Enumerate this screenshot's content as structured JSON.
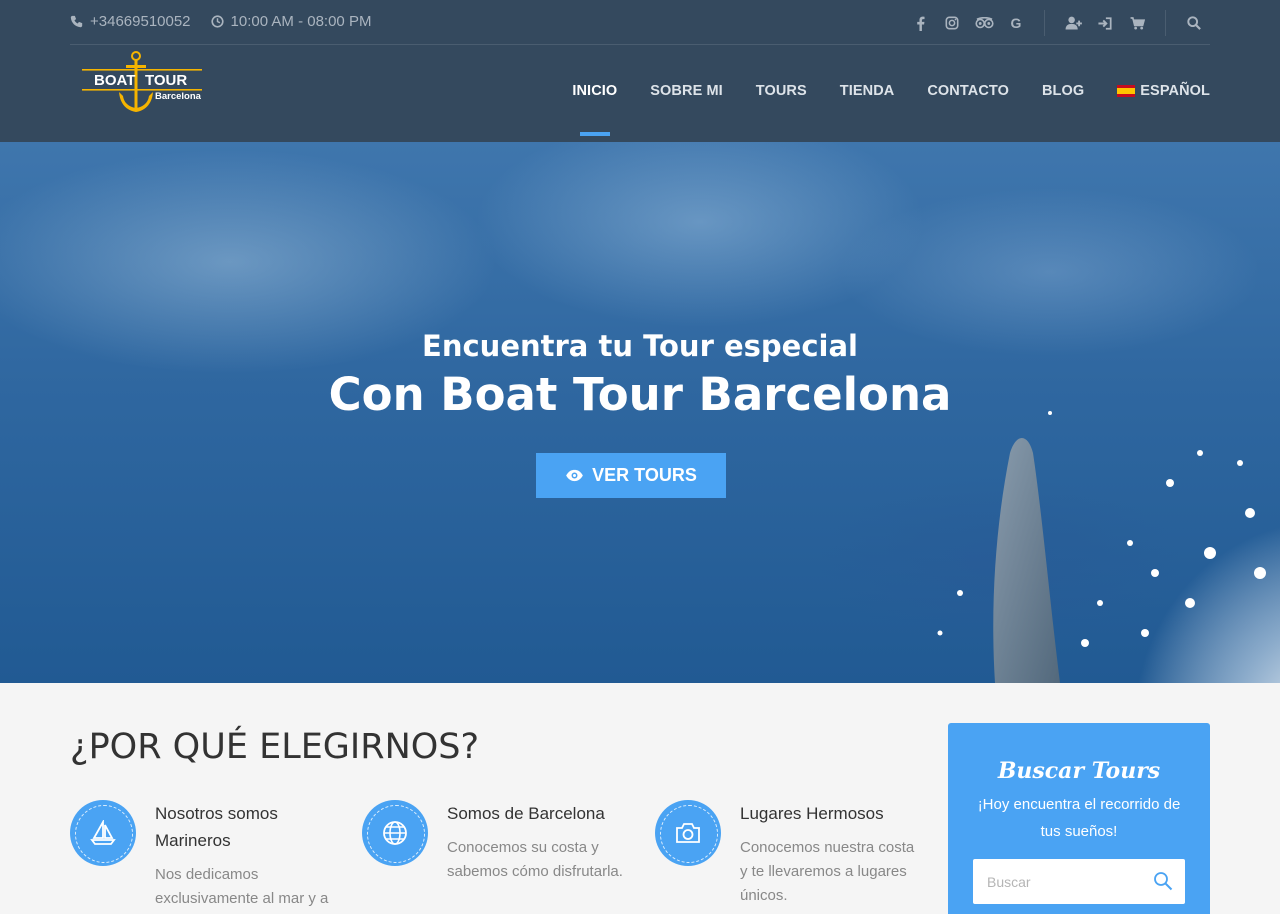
{
  "topbar": {
    "phone": "+34669510052",
    "hours": "10:00 AM - 08:00 PM",
    "social": [
      "facebook-icon",
      "instagram-icon",
      "tripadvisor-icon",
      "google-icon"
    ],
    "google_letter": "G",
    "actions": [
      "add-user-icon",
      "sign-in-icon",
      "cart-icon",
      "search-icon"
    ]
  },
  "logo": {
    "word1": "BOAT",
    "word2": "TOUR",
    "word3": "Barcelona"
  },
  "nav": {
    "items": [
      "INICIO",
      "SOBRE MI",
      "TOURS",
      "TIENDA",
      "CONTACTO",
      "BLOG"
    ],
    "language": "ESPAÑOL",
    "active": "INICIO"
  },
  "hero": {
    "subtitle": "Encuentra tu Tour especial",
    "title": "Con Boat Tour Barcelona",
    "button": "VER TOURS"
  },
  "why": {
    "title": "¿POR QUÉ ELEGIRNOS?",
    "features": [
      {
        "icon": "sailboat-icon",
        "title": "Nosotros somos Marineros",
        "text": "Nos dedicamos exclusivamente al mar y a"
      },
      {
        "icon": "globe-icon",
        "title": "Somos de Barcelona",
        "text": "Conocemos su costa y sabemos cómo disfrutarla."
      },
      {
        "icon": "camera-icon",
        "title": "Lugares Hermosos",
        "text": "Conocemos nuestra costa y te llevaremos a lugares únicos."
      }
    ]
  },
  "search": {
    "title": "Buscar Tours",
    "subtitle": "¡Hoy encuentra el recorrido de tus sueños!",
    "placeholder": "Buscar"
  },
  "colors": {
    "header_bg": "#34495e",
    "accent": "#4aa3f3",
    "logo_gold": "#f5b400"
  }
}
